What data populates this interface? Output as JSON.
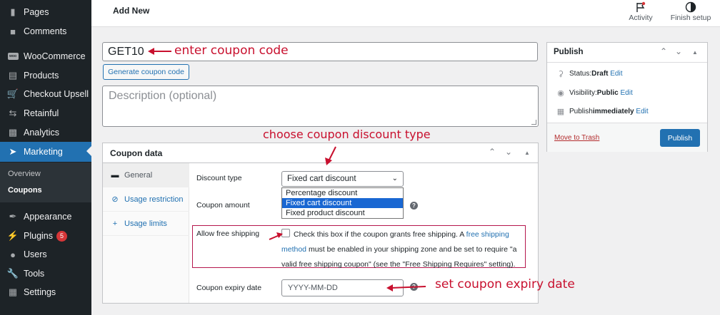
{
  "sidebar": {
    "items": [
      {
        "label": "Pages",
        "icon": "pages-icon"
      },
      {
        "label": "Comments",
        "icon": "comments-icon"
      },
      {
        "label": "WooCommerce",
        "icon": "woocommerce-icon"
      },
      {
        "label": "Products",
        "icon": "products-icon"
      },
      {
        "label": "Checkout Upsell",
        "icon": "cart-icon"
      },
      {
        "label": "Retainful",
        "icon": "retainful-icon"
      },
      {
        "label": "Analytics",
        "icon": "analytics-icon"
      },
      {
        "label": "Marketing",
        "icon": "marketing-icon"
      },
      {
        "label": "Appearance",
        "icon": "appearance-icon"
      },
      {
        "label": "Plugins",
        "icon": "plugins-icon",
        "badge": "5"
      },
      {
        "label": "Users",
        "icon": "users-icon"
      },
      {
        "label": "Tools",
        "icon": "tools-icon"
      },
      {
        "label": "Settings",
        "icon": "settings-icon"
      }
    ],
    "submenu": [
      "Overview",
      "Coupons"
    ],
    "active_color": "#2271b1"
  },
  "header": {
    "title": "Add New",
    "activity_label": "Activity",
    "finish_setup_label": "Finish setup"
  },
  "coupon": {
    "code": "GET10",
    "generate_button": "Generate coupon code",
    "description_placeholder": "Description (optional)"
  },
  "coupon_data": {
    "title": "Coupon data",
    "tabs": [
      "General",
      "Usage restriction",
      "Usage limits"
    ],
    "discount_type_label": "Discount type",
    "discount_type_value": "Fixed cart discount",
    "discount_options": [
      "Percentage discount",
      "Fixed cart discount",
      "Fixed product discount"
    ],
    "coupon_amount_label": "Coupon amount",
    "free_shipping_label": "Allow free shipping",
    "free_shipping_text_before": "Check this box if the coupon grants free shipping. A ",
    "free_shipping_link": "free shipping method",
    "free_shipping_text_after": " must be enabled in your shipping zone and be set to require \"a valid free shipping coupon\" (see the \"Free Shipping Requires\" setting).",
    "expiry_label": "Coupon expiry date",
    "expiry_placeholder": "YYYY-MM-DD"
  },
  "publish": {
    "title": "Publish",
    "status_label": "Status: ",
    "status_value": "Draft",
    "visibility_label": "Visibility: ",
    "visibility_value": "Public",
    "schedule_label": "Publish ",
    "schedule_value": "immediately",
    "edit_link": "Edit",
    "trash_link": "Move to Trash",
    "publish_button": "Publish"
  },
  "annotations": {
    "code_note": "enter coupon code",
    "type_note": "choose coupon discount type",
    "expiry_note": "set coupon expiry date",
    "color": "#c8102e"
  }
}
